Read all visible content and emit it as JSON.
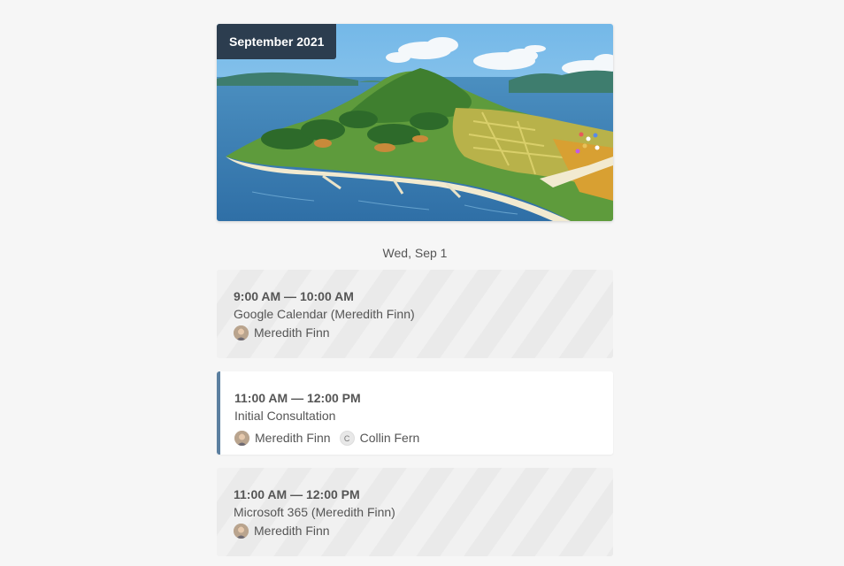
{
  "header": {
    "month_label": "September 2021"
  },
  "hero": {
    "image": "painted-island-landscape"
  },
  "day": {
    "label": "Wed, Sep 1"
  },
  "events": [
    {
      "time": "9:00 AM — 10:00 AM",
      "title": "Google Calendar (Meredith Finn)",
      "status": "busy",
      "attendees": [
        {
          "name": "Meredith Finn",
          "avatar": "photo"
        }
      ]
    },
    {
      "time": "11:00 AM — 12:00 PM",
      "title": "Initial Consultation",
      "status": "booked",
      "attendees": [
        {
          "name": "Meredith Finn",
          "avatar": "photo"
        },
        {
          "name": "Collin Fern",
          "avatar": "initial",
          "initial": "C"
        }
      ]
    },
    {
      "time": "11:00 AM — 12:00 PM",
      "title": "Microsoft 365 (Meredith Finn)",
      "status": "busy",
      "attendees": [
        {
          "name": "Meredith Finn",
          "avatar": "photo"
        }
      ]
    }
  ],
  "colors": {
    "badge_bg": "#2c3d4f",
    "accent": "#5b7fa0",
    "page_bg": "#f6f6f6"
  }
}
